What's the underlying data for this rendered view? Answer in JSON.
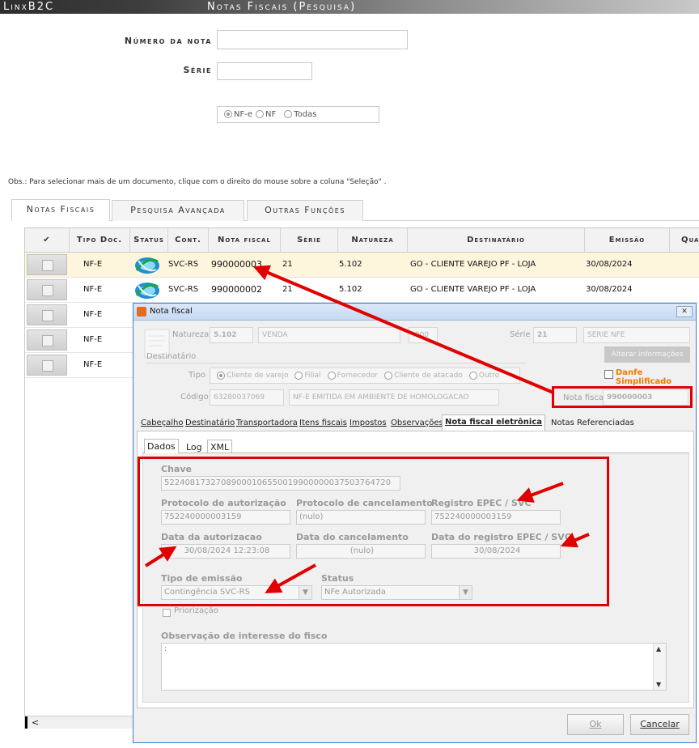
{
  "app": {
    "brand": "LinxB2C",
    "title": "Notas Fiscais (Pesquisa)"
  },
  "search": {
    "numero_label": "Número da nota",
    "serie_label": "Série",
    "radio_nfe": "NF-e",
    "radio_nf": "NF",
    "radio_todas": "Todas"
  },
  "obs": "Obs.: Para selecionar mais de um documento, clique com o direito do mouse sobre a coluna \"Seleção\" .",
  "page_tabs": [
    "Notas Fiscais",
    "Pesquisa Avançada",
    "Outras Funções"
  ],
  "grid": {
    "headers": [
      "✔",
      "Tipo Doc.",
      "Status",
      "Cont.",
      "Nota fiscal",
      "Série",
      "Natureza",
      "Destinatário",
      "Emissão",
      "Qua"
    ],
    "rows": [
      {
        "tipo": "NF-E",
        "cont": "SVC-RS",
        "nota": "990000003",
        "serie": "21",
        "natureza": "5.102",
        "destinatario": "GO - CLIENTE VAREJO PF - LOJA",
        "emissao": "30/08/2024"
      },
      {
        "tipo": "NF-E",
        "cont": "SVC-RS",
        "nota": "990000002",
        "serie": "21",
        "natureza": "5.102",
        "destinatario": "GO - CLIENTE VAREJO PF - LOJA",
        "emissao": "30/08/2024"
      },
      {
        "tipo": "NF-E"
      },
      {
        "tipo": "NF-E"
      },
      {
        "tipo": "NF-E"
      }
    ],
    "scroll_left": "<"
  },
  "dialog": {
    "title": "Nota fiscal",
    "close": "✕",
    "natureza_label": "Natureza",
    "natureza_code": "5.102",
    "natureza_desc": "VENDA",
    "natureza_extra": ",000",
    "serie_label": "Série",
    "serie_value": "21",
    "serie_desc": "SERIE NFE",
    "alterar_btn": "Alterar informações",
    "destinatario_label": "Destinatário",
    "tipo_label": "Tipo",
    "tipo_options": [
      "Cliente de varejo",
      "Filial",
      "Fornecedor",
      "Cliente de atacado",
      "Outro"
    ],
    "danfe_label": "Danfe Simplificado",
    "codigo_label": "Código",
    "codigo_value": "63280037069",
    "codigo_desc": "NF-E EMITIDA EM AMBIENTE DE HOMOLOGACAO",
    "nota_fiscal_label": "Nota fiscal",
    "nota_fiscal_value": "990000003",
    "tabs": [
      "Cabeçalho",
      "Destinatário",
      "Transportadora",
      "Itens fiscais",
      "Impostos",
      "Observações",
      "Nota fiscal eletrônica",
      "Notas Referenciadas"
    ],
    "subtabs": [
      "Dados",
      "Log",
      "XML"
    ],
    "chave_label": "Chave",
    "chave_value": "52240817327089000106550019900000037503764720",
    "protocolo_aut_label": "Protocolo de autorização",
    "protocolo_aut_value": "752240000003159",
    "protocolo_canc_label": "Protocolo de cancelamento",
    "protocolo_canc_value": "(nulo)",
    "registro_epec_label": "Registro EPEC / SVC",
    "registro_epec_value": "752240000003159",
    "data_aut_label": "Data da autorizacao",
    "data_aut_value": "30/08/2024 12:23:08",
    "data_canc_label": "Data do cancelamento",
    "data_canc_value": "(nulo)",
    "data_epec_label": "Data do registro EPEC / SVC",
    "data_epec_value": "30/08/2024",
    "tipo_emissao_label": "Tipo de emissão",
    "tipo_emissao_value": "Contingência SVC-RS",
    "status_label": "Status",
    "status_value": "NFe Autorizada",
    "priorizacao_label": "Priorização",
    "obs_fisco_label": "Observação de interesse do fisco",
    "obs_fisco_value": ":",
    "ok_btn": "Ok",
    "cancelar_btn": "Cancelar"
  },
  "colors": {
    "highlight_row": "#fdf5dc",
    "annotation_red": "#e00000",
    "danfe_orange": "#f07a00",
    "dialog_border": "#3b7ed6"
  }
}
